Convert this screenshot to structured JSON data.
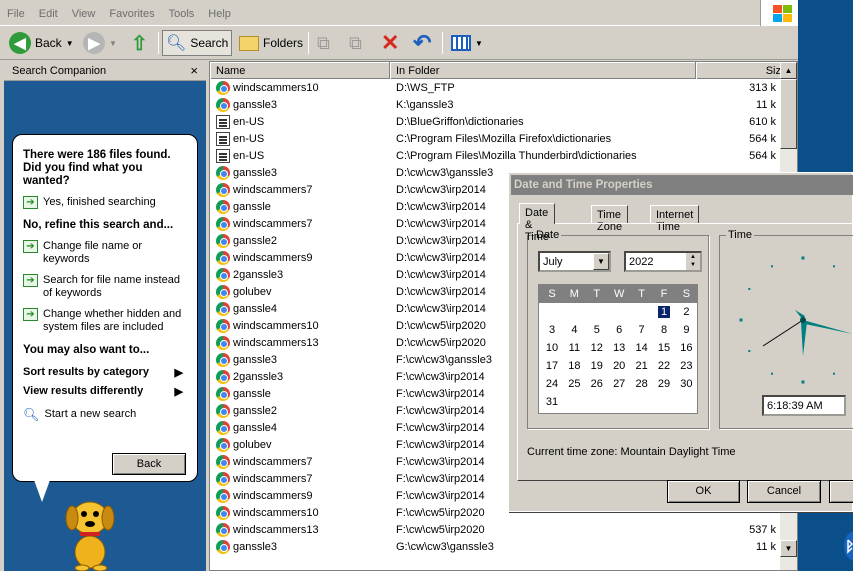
{
  "menu": [
    "File",
    "Edit",
    "View",
    "Favorites",
    "Tools",
    "Help"
  ],
  "toolbar": {
    "back": "Back",
    "search": "Search",
    "folders": "Folders"
  },
  "search_companion": {
    "title": "Search Companion",
    "close": "×",
    "found": "There were 186 files found. Did you find what you wanted?",
    "finished": "Yes, finished searching",
    "refine": "No, refine this search and...",
    "refine_opts": [
      "Change file name or keywords",
      "Search for file name instead of keywords",
      "Change whether hidden and system files are included"
    ],
    "also": "You may also want to...",
    "sort": "Sort results by category",
    "view": "View results differently",
    "new_search": "Start a new search",
    "back_btn": "Back"
  },
  "columns": {
    "name": "Name",
    "folder": "In Folder",
    "size": "Siz"
  },
  "files": [
    {
      "icon": "chrome",
      "name": "windscammers10",
      "folder": "D:\\WS_FTP",
      "size": "313 k"
    },
    {
      "icon": "chrome",
      "name": "ganssle3",
      "folder": "K:\\ganssle3",
      "size": "11 k"
    },
    {
      "icon": "dic",
      "name": "en-US",
      "folder": "D:\\BlueGriffon\\dictionaries",
      "size": "610 k"
    },
    {
      "icon": "dic",
      "name": "en-US",
      "folder": "C:\\Program Files\\Mozilla Firefox\\dictionaries",
      "size": "564 k"
    },
    {
      "icon": "dic",
      "name": "en-US",
      "folder": "C:\\Program Files\\Mozilla Thunderbird\\dictionaries",
      "size": "564 k"
    },
    {
      "icon": "chrome",
      "name": "ganssle3",
      "folder": "D:\\cw\\cw3\\ganssle3",
      "size": ""
    },
    {
      "icon": "chrome",
      "name": "windscammers7",
      "folder": "D:\\cw\\cw3\\irp2014",
      "size": ""
    },
    {
      "icon": "chrome",
      "name": "ganssle",
      "folder": "D:\\cw\\cw3\\irp2014",
      "size": ""
    },
    {
      "icon": "chrome",
      "name": "windscammers7",
      "folder": "D:\\cw\\cw3\\irp2014",
      "size": ""
    },
    {
      "icon": "chrome",
      "name": "ganssle2",
      "folder": "D:\\cw\\cw3\\irp2014",
      "size": ""
    },
    {
      "icon": "chrome",
      "name": "windscammers9",
      "folder": "D:\\cw\\cw3\\irp2014",
      "size": ""
    },
    {
      "icon": "chrome",
      "name": "2ganssle3",
      "folder": "D:\\cw\\cw3\\irp2014",
      "size": ""
    },
    {
      "icon": "chrome",
      "name": "golubev",
      "folder": "D:\\cw\\cw3\\irp2014",
      "size": ""
    },
    {
      "icon": "chrome",
      "name": "ganssle4",
      "folder": "D:\\cw\\cw3\\irp2014",
      "size": ""
    },
    {
      "icon": "chrome",
      "name": "windscammers10",
      "folder": "D:\\cw\\cw5\\irp2020",
      "size": ""
    },
    {
      "icon": "chrome",
      "name": "windscammers13",
      "folder": "D:\\cw\\cw5\\irp2020",
      "size": ""
    },
    {
      "icon": "chrome",
      "name": "ganssle3",
      "folder": "F:\\cw\\cw3\\ganssle3",
      "size": ""
    },
    {
      "icon": "chrome",
      "name": "2ganssle3",
      "folder": "F:\\cw\\cw3\\irp2014",
      "size": ""
    },
    {
      "icon": "chrome",
      "name": "ganssle",
      "folder": "F:\\cw\\cw3\\irp2014",
      "size": ""
    },
    {
      "icon": "chrome",
      "name": "ganssle2",
      "folder": "F:\\cw\\cw3\\irp2014",
      "size": ""
    },
    {
      "icon": "chrome",
      "name": "ganssle4",
      "folder": "F:\\cw\\cw3\\irp2014",
      "size": ""
    },
    {
      "icon": "chrome",
      "name": "golubev",
      "folder": "F:\\cw\\cw3\\irp2014",
      "size": ""
    },
    {
      "icon": "chrome",
      "name": "windscammers7",
      "folder": "F:\\cw\\cw3\\irp2014",
      "size": ""
    },
    {
      "icon": "chrome",
      "name": "windscammers7",
      "folder": "F:\\cw\\cw3\\irp2014",
      "size": ""
    },
    {
      "icon": "chrome",
      "name": "windscammers9",
      "folder": "F:\\cw\\cw3\\irp2014",
      "size": ""
    },
    {
      "icon": "chrome",
      "name": "windscammers10",
      "folder": "F:\\cw\\cw5\\irp2020",
      "size": ""
    },
    {
      "icon": "chrome",
      "name": "windscammers13",
      "folder": "F:\\cw\\cw5\\irp2020",
      "size": "537 k"
    },
    {
      "icon": "chrome",
      "name": "ganssle3",
      "folder": "G:\\cw\\cw3\\ganssle3",
      "size": "11 k"
    }
  ],
  "dialog": {
    "title": "Date and Time Properties",
    "tabs": [
      "Date & Time",
      "Time Zone",
      "Internet Time"
    ],
    "date_group": "Date",
    "time_group": "Time",
    "month": "July",
    "year": "2022",
    "weekdays": [
      "S",
      "M",
      "T",
      "W",
      "T",
      "F",
      "S"
    ],
    "days": [
      [
        "",
        "",
        "",
        "",
        "",
        "1",
        "2"
      ],
      [
        "3",
        "4",
        "5",
        "6",
        "7",
        "8",
        "9"
      ],
      [
        "10",
        "11",
        "12",
        "13",
        "14",
        "15",
        "16"
      ],
      [
        "17",
        "18",
        "19",
        "20",
        "21",
        "22",
        "23"
      ],
      [
        "24",
        "25",
        "26",
        "27",
        "28",
        "29",
        "30"
      ],
      [
        "31",
        "",
        "",
        "",
        "",
        "",
        ""
      ]
    ],
    "selected_day": "1",
    "time": "6:18:39 AM",
    "timezone": "Current time zone:  Mountain Daylight Time",
    "ok": "OK",
    "cancel": "Cancel"
  }
}
